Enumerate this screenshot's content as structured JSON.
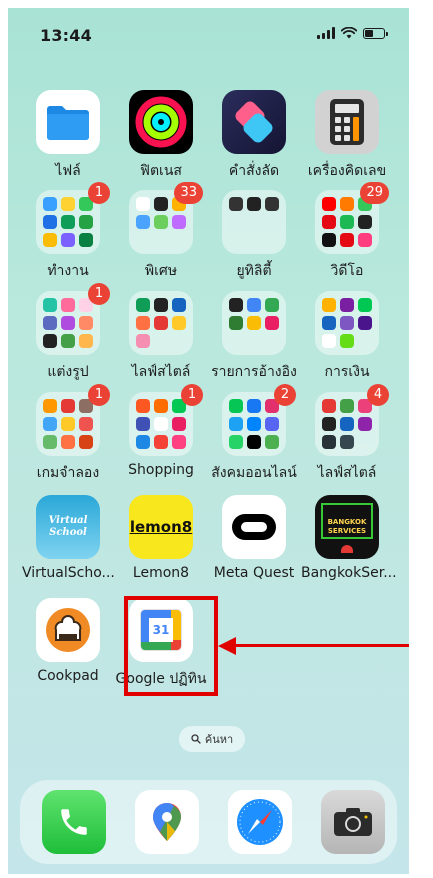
{
  "status_bar": {
    "time": "13:44"
  },
  "apps": [
    {
      "label": "ไฟล์",
      "icon": "files-icon"
    },
    {
      "label": "ฟิตเนส",
      "icon": "fitness-icon"
    },
    {
      "label": "คำสั่งลัด",
      "icon": "shortcuts-icon"
    },
    {
      "label": "เครื่องคิดเลข",
      "icon": "calculator-icon"
    },
    {
      "label": "ทำงาน",
      "icon": "folder-icon",
      "badge": "1"
    },
    {
      "label": "พิเศษ",
      "icon": "folder-icon",
      "badge": "33"
    },
    {
      "label": "ยูทิลิตี้",
      "icon": "folder-icon"
    },
    {
      "label": "วิดีโอ",
      "icon": "folder-icon",
      "badge": "29"
    },
    {
      "label": "แต่งรูป",
      "icon": "folder-icon",
      "badge": "1"
    },
    {
      "label": "ไลฟ์สไตล์",
      "icon": "folder-icon"
    },
    {
      "label": "รายการอ้างอิง",
      "icon": "folder-icon"
    },
    {
      "label": "การเงิน",
      "icon": "folder-icon"
    },
    {
      "label": "เกมจำลอง",
      "icon": "folder-icon",
      "badge": "1"
    },
    {
      "label": "Shopping",
      "icon": "folder-icon",
      "badge": "1"
    },
    {
      "label": "สังคมออนไลน์",
      "icon": "folder-icon",
      "badge": "2"
    },
    {
      "label": "ไลฟ์สไตล์",
      "icon": "folder-icon",
      "badge": "4"
    },
    {
      "label": "VirtualScho...",
      "icon": "virtual-school-icon",
      "icon_text": "Virtual School"
    },
    {
      "label": "Lemon8",
      "icon": "lemon8-icon",
      "icon_text": "lemon8"
    },
    {
      "label": "Meta Quest",
      "icon": "meta-quest-icon"
    },
    {
      "label": "BangkokSer...",
      "icon": "bangkok-services-icon",
      "icon_text": "BANGKOK SERVICES"
    },
    {
      "label": "Cookpad",
      "icon": "cookpad-icon"
    },
    {
      "label": "Google ปฏิทิน",
      "icon": "google-calendar-icon",
      "icon_text": "31"
    }
  ],
  "search": {
    "label": "ค้นหา",
    "icon": "search-icon"
  },
  "dock": [
    {
      "name": "phone",
      "icon": "phone-icon"
    },
    {
      "name": "google-maps",
      "icon": "maps-pin-icon"
    },
    {
      "name": "safari",
      "icon": "compass-icon"
    },
    {
      "name": "camera",
      "icon": "camera-icon"
    }
  ],
  "colors": {
    "highlight": "#e00000",
    "badge": "#ea4335"
  }
}
